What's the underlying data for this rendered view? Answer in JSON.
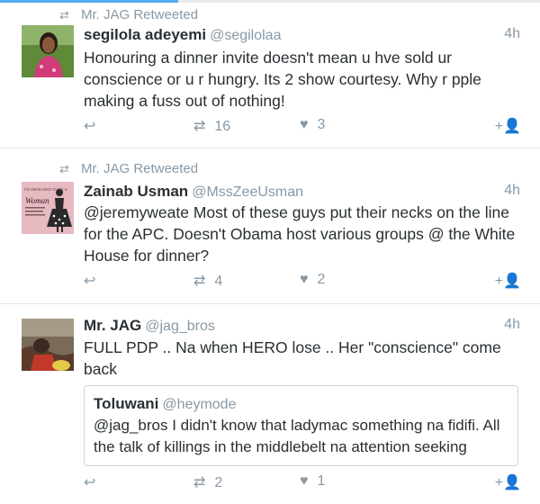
{
  "colors": {
    "accent": "#55acee",
    "muted": "#8899a6",
    "text": "#292f33",
    "divider": "#e1e8ed"
  },
  "tweets": [
    {
      "context": "Mr. JAG Retweeted",
      "name": "segilola adeyemi",
      "handle": "@segilolaa",
      "time": "4h",
      "text": "Honouring a dinner invite doesn't mean u hve sold ur conscience or u r hungry. Its 2 show courtesy. Why r pple making a fuss out of nothing!",
      "retweets": "16",
      "likes": "3"
    },
    {
      "context": "Mr. JAG Retweeted",
      "name": "Zainab Usman",
      "handle": "@MssZeeUsman",
      "time": "4h",
      "text": "@jeremyweate Most of these guys put their necks on the line for the APC. Doesn't Obama host various groups @ the White House for dinner?",
      "retweets": "4",
      "likes": "2",
      "avatar_text": [
        "I'M DESIGNED TO BE A",
        "Woman"
      ]
    },
    {
      "name": "Mr. JAG",
      "handle": "@jag_bros",
      "time": "4h",
      "text": "FULL PDP .. Na when HERO lose .. Her \"conscience\" come back",
      "quote": {
        "name": "Toluwani",
        "handle": "@heymode",
        "text": "@jag_bros  I didn't know that ladymac something na fidifi. All the talk of killings in the middlebelt na attention seeking"
      },
      "retweets": "2",
      "likes": "1"
    }
  ],
  "icons": {
    "retweet_context": "retweet-icon",
    "reply": "reply-icon",
    "retweet": "retweet-icon",
    "like": "heart-icon",
    "follow": "follow-user-icon"
  }
}
